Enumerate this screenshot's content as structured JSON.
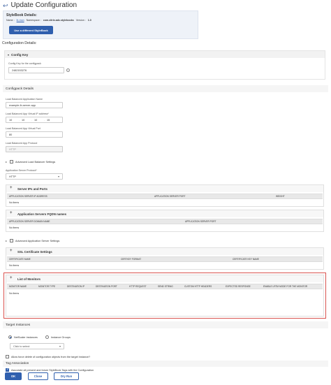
{
  "header": {
    "back_icon": "back-arrow-icon",
    "title": "Update Configuration"
  },
  "stylebook": {
    "heading": "StyleBook Details:",
    "name_label": "Name :",
    "name_value": "lb-mon",
    "namespace_label": "Namespace :",
    "namespace_value": "com.citrix.adc.stylebooks",
    "version_label": "Version :",
    "version_value": "1.0",
    "use_different_button": "Use a different StyleBook"
  },
  "config_details_label": "Configuration Details:",
  "config_key": {
    "header": "Config Key",
    "field_label": "Config Key for the configpack",
    "field_value": "2482153276"
  },
  "configpack": {
    "header": "Configpack Details",
    "app_name_label": "Load Balanced Application Name",
    "app_name_value": "example-lb-server-app",
    "vip_label": "Load Balanced App Virtual IP address*",
    "vip_octets": [
      "10",
      "10",
      "10",
      "15"
    ],
    "port_label": "Load Balanced App Virtual Port",
    "port_value": "80",
    "protocol_label": "Load Balanced App Protocol",
    "protocol_value": "HTTP",
    "adv_lb_label": "Advanced Load Balancer Settings",
    "server_protocol_label": "Application Server Protocol*",
    "server_protocol_value": "HTTP",
    "server_ips": {
      "header": "Server IPs and Ports",
      "columns": [
        "APPLICATION SERVER IP ADDRESS",
        "APPLICATION SERVER PORT",
        "WEIGHT"
      ],
      "empty": "No items"
    },
    "fqdn": {
      "header": "Application Servers FQDN names",
      "columns": [
        "APPLICATION SERVER DOMAIN NAME",
        "APPLICATION SERVER PORT"
      ],
      "empty": "No items"
    },
    "adv_app_label": "Advanced Application Server Settings",
    "ssl": {
      "header": "SSL Certificate Settings",
      "columns": [
        "CERTIFICATE NAME",
        "CERTKEY FORMAT",
        "CERTIFICATE KEY NAME"
      ],
      "empty": "No items"
    },
    "monitors": {
      "header": "List of Monitors",
      "columns": [
        "MONITOR NAME",
        "MONITOR TYPE",
        "DESTINATION IP",
        "DESTINATION PORT",
        "HTTP REQUEST",
        "SEND STRING",
        "CUSTOM HTTP HEADERS",
        "EXPECTED RESPONSE",
        "ENABLE LRTM MODE FOR THE MONITOR"
      ],
      "empty": "No items"
    }
  },
  "target": {
    "header": "Target Instances",
    "opt_netscaler": "NetScaler instances",
    "opt_groups": "Instance Groups",
    "select_placeholder": "Click to select",
    "force_delete": "Allow force delete of configuration objects from the target instance?"
  },
  "tag": {
    "header": "Tag Association",
    "assoc_label": "Associate all present and future StyleBook Tags with the Configuration"
  },
  "footer": {
    "ok": "OK",
    "close": "Close",
    "dry_run": "Dry Run"
  }
}
